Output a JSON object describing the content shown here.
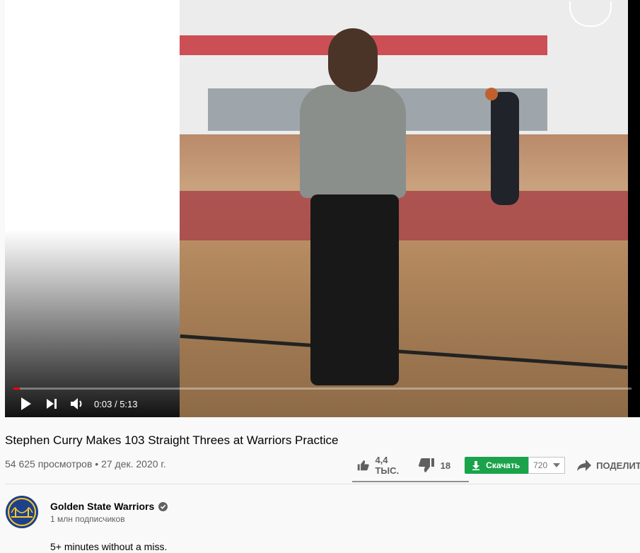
{
  "player": {
    "time_current": "0:03",
    "time_separator": "/",
    "time_total": "5:13",
    "progress_fraction": 0.01
  },
  "video": {
    "title": "Stephen Curry Makes 103 Straight Threes at Warriors Practice",
    "views": "54 625 просмотров",
    "dot": "•",
    "date": "27 дек. 2020 г."
  },
  "actions": {
    "like_count": "4,4 ТЫС.",
    "dislike_count": "18",
    "like_ratio": 0.996,
    "download_label": "Скачать",
    "quality_value": "720",
    "share_label": "ПОДЕЛИТЬСЯ"
  },
  "channel": {
    "name": "Golden State Warriors",
    "subscribers": "1 млн подписчиков",
    "verified": true
  },
  "description": "5+ minutes without a miss.",
  "colors": {
    "accent_red": "#ff0000",
    "download_green": "#1aa34a",
    "channel_blue": "#1d428a",
    "channel_gold": "#ffc72c"
  },
  "icons": [
    "play-icon",
    "next-icon",
    "volume-icon",
    "thumbs-up-icon",
    "thumbs-down-icon",
    "download-arrow-icon",
    "chevron-down-icon",
    "share-icon",
    "verified-check-icon"
  ]
}
